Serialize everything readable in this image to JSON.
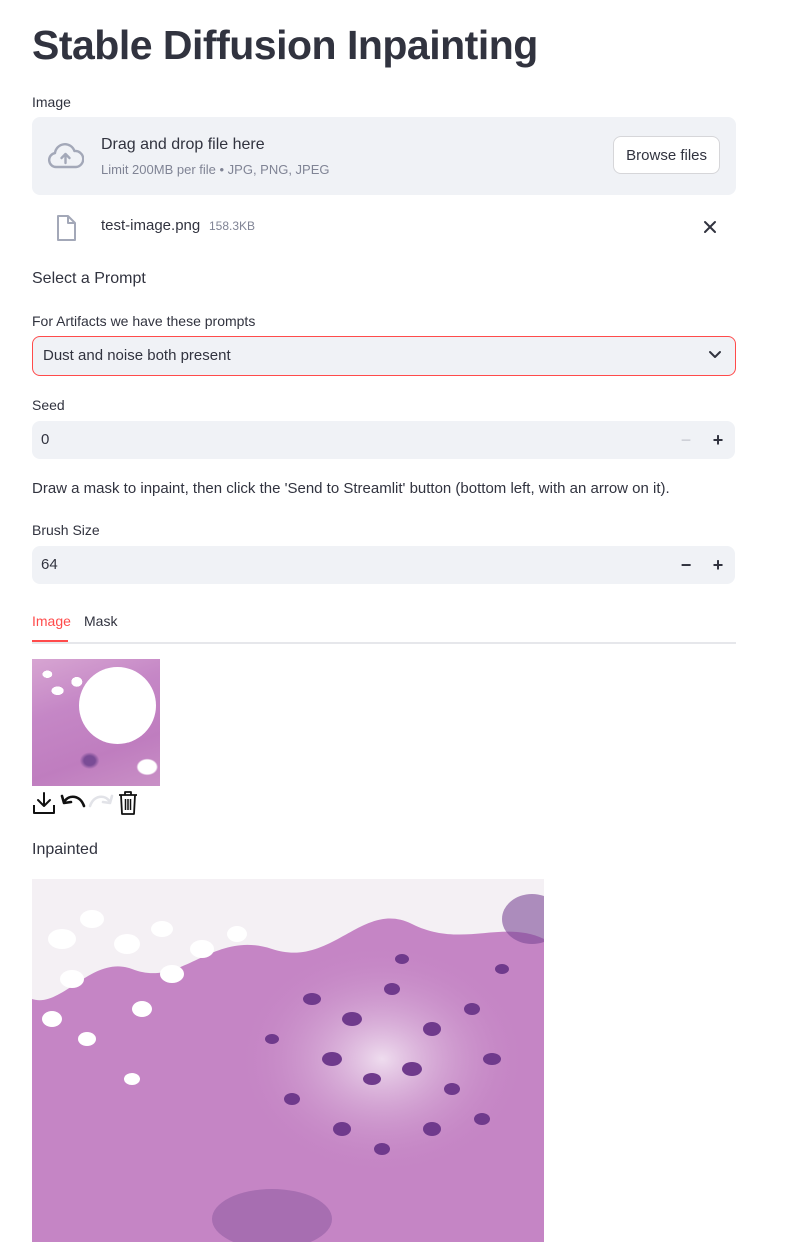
{
  "page": {
    "title": "Stable Diffusion Inpainting"
  },
  "uploader": {
    "label": "Image",
    "drop_title": "Drag and drop file here",
    "drop_subtitle": "Limit 200MB per file • JPG, PNG, JPEG",
    "browse_label": "Browse files",
    "file": {
      "name": "test-image.png",
      "size": "158.3KB"
    }
  },
  "prompt_section": {
    "heading": "Select a Prompt",
    "select_label": "For Artifacts we have these prompts",
    "selected_value": "Dust and noise both present"
  },
  "seed": {
    "label": "Seed",
    "value": "0",
    "minus": "−",
    "plus": "+"
  },
  "instructions": "Draw a mask to inpaint, then click the 'Send to Streamlit' button (bottom left, with an arrow on it).",
  "brush": {
    "label": "Brush Size",
    "value": "64",
    "minus": "−",
    "plus": "+"
  },
  "tabs": [
    {
      "label": "Image",
      "active": true
    },
    {
      "label": "Mask",
      "active": false
    }
  ],
  "canvas_toolbar": [
    {
      "icon": "download-icon"
    },
    {
      "icon": "undo-icon"
    },
    {
      "icon": "redo-icon"
    },
    {
      "icon": "trash-icon"
    }
  ],
  "result": {
    "label": "Inpainted"
  },
  "colors": {
    "accent": "#ff4b4b",
    "text": "#31333f",
    "muted": "#808495",
    "widget_bg": "#f0f2f6"
  }
}
